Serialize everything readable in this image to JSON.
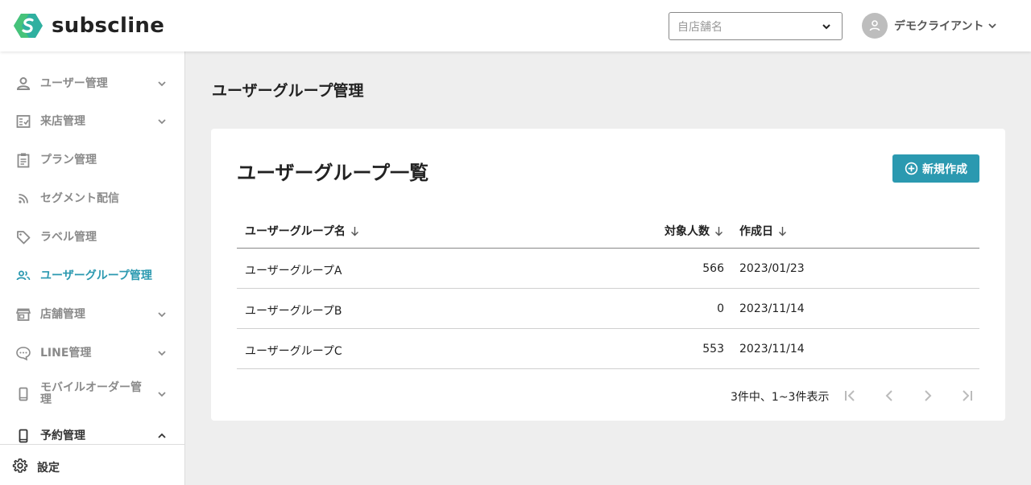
{
  "brand": {
    "name": "subscline",
    "color": "#2b99b0"
  },
  "header": {
    "store_placeholder": "自店舗名",
    "user_name": "デモクライアント"
  },
  "sidebar": {
    "items": [
      {
        "label": "ユーザー管理",
        "icon": "person-icon",
        "expandable": true,
        "active": false
      },
      {
        "label": "来店管理",
        "icon": "checklist-icon",
        "expandable": true,
        "active": false
      },
      {
        "label": "プラン管理",
        "icon": "clipboard-icon",
        "expandable": false,
        "active": false
      },
      {
        "label": "セグメント配信",
        "icon": "rss-icon",
        "expandable": false,
        "active": false
      },
      {
        "label": "ラベル管理",
        "icon": "tag-icon",
        "expandable": false,
        "active": false
      },
      {
        "label": "ユーザーグループ管理",
        "icon": "group-icon",
        "expandable": false,
        "active": true
      },
      {
        "label": "店舗管理",
        "icon": "store-icon",
        "expandable": true,
        "active": false
      },
      {
        "label": "LINE管理",
        "icon": "chat-icon",
        "expandable": true,
        "active": false
      },
      {
        "label": "モバイルオーダー管理",
        "icon": "mobile-icon",
        "expandable": true,
        "active": false
      },
      {
        "label": "予約管理",
        "icon": "mobile-icon",
        "expandable": true,
        "expanded": true,
        "active": false
      }
    ],
    "settings_label": "設定"
  },
  "main": {
    "page_title": "ユーザーグループ管理",
    "card_title": "ユーザーグループ一覧",
    "new_button_label": "新規作成",
    "table": {
      "headers": [
        "ユーザーグループ名",
        "対象人数",
        "作成日"
      ],
      "rows": [
        {
          "name": "ユーザーグループA",
          "count": "566",
          "date": "2023/01/23"
        },
        {
          "name": "ユーザーグループB",
          "count": "0",
          "date": "2023/11/14"
        },
        {
          "name": "ユーザーグループC",
          "count": "553",
          "date": "2023/11/14"
        }
      ]
    },
    "pagination": {
      "summary": "3件中、1~3件表示"
    }
  }
}
